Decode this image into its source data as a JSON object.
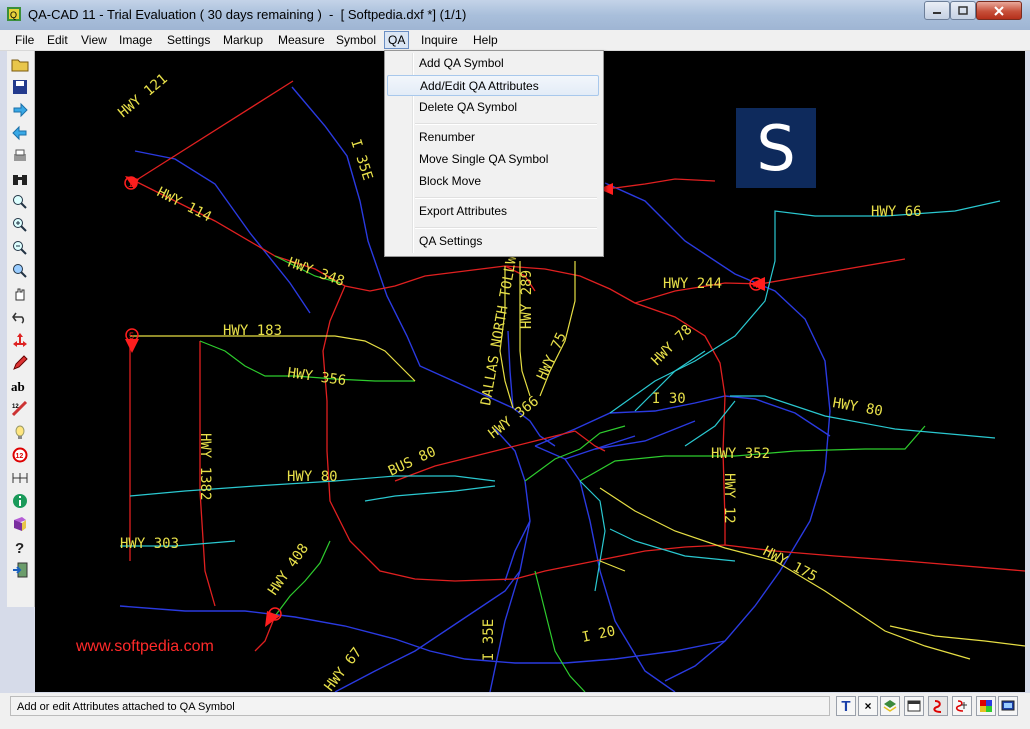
{
  "window": {
    "title": "QA-CAD 11 - Trial Evaluation ( 30 days remaining )  -  [ Softpedia.dxf *] (1/1)"
  },
  "menubar": [
    "File",
    "Edit",
    "View",
    "Image",
    "Settings",
    "Markup",
    "Measure",
    "Symbol",
    "QA",
    "Inquire",
    "Help"
  ],
  "qa_menu": {
    "items": [
      {
        "label": "Add QA Symbol",
        "highlighted": false
      },
      {
        "label": "Add/Edit QA Attributes",
        "highlighted": true
      },
      {
        "label": "Delete QA Symbol",
        "highlighted": false
      },
      {
        "label": "Renumber",
        "highlighted": false
      },
      {
        "label": "Move Single QA Symbol",
        "highlighted": false
      },
      {
        "label": "Block Move",
        "highlighted": false
      },
      {
        "label": "Export Attributes",
        "highlighted": false
      },
      {
        "label": "QA Settings",
        "highlighted": false
      }
    ]
  },
  "toolbar_icons": [
    "open-icon",
    "save-icon",
    "forward-arrow-icon",
    "back-arrow-icon",
    "print-icon",
    "binoculars-icon",
    "zoom-icon",
    "zoom-in-icon",
    "zoom-out-icon",
    "zoom-window-icon",
    "pan-hand-icon",
    "undo-icon",
    "move-icon",
    "pencil-icon",
    "text-icon",
    "ruler-icon",
    "bulb-icon",
    "qa-symbol-icon",
    "dimension-icon",
    "info-icon",
    "book-icon",
    "help-icon",
    "exit-icon"
  ],
  "map": {
    "labels": [
      "HWY 121",
      "I 35E",
      "HWY 114",
      "HWY 348",
      "HWY 183",
      "HWY 356",
      "HWY 66",
      "HWY 244",
      "HWY 78",
      "I 30",
      "HWY 80",
      "DALLAS NORTH TOLLWAY",
      "HWY 289",
      "HWY 75",
      "HWY 366",
      "BUS 80",
      "HWY 352",
      "HWY 12",
      "HWY 1382",
      "HWY 303",
      "HWY 408",
      "HWY 175",
      "I 35E",
      "I 20",
      "HWY 67",
      "HWY 80"
    ],
    "markers": [
      "1",
      "4",
      "5"
    ],
    "watermark_link": "www.softpedia.com",
    "logo_letter": "S",
    "colors": {
      "background": "#000000",
      "labels": "#e8e04a",
      "markers": "#ff1e1e"
    }
  },
  "statusbar": {
    "text": "Add or edit Attributes attached to QA Symbol",
    "buttons": [
      "T",
      "×",
      "layer-icon",
      "window-icon",
      "qa-red-icon",
      "qa-multi-icon",
      "color-icon",
      "screen-icon"
    ]
  }
}
